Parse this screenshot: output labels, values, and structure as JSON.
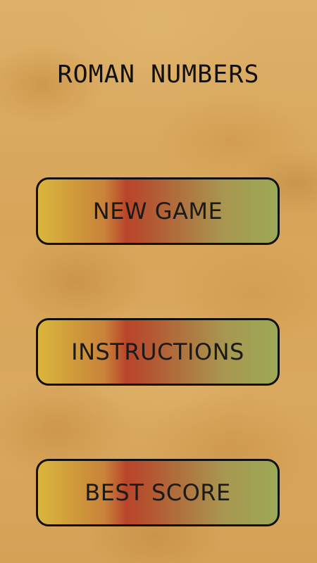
{
  "title": "ROMAN NUMBERS",
  "menu": {
    "new_game_label": "NEW GAME",
    "instructions_label": "INSTRUCTIONS",
    "best_score_label": "BEST SCORE"
  },
  "colors": {
    "background": "#d9a85a",
    "button_left": "#d9b63c",
    "button_mid": "#b8442a",
    "button_right": "#9ca957",
    "text": "#111111"
  }
}
